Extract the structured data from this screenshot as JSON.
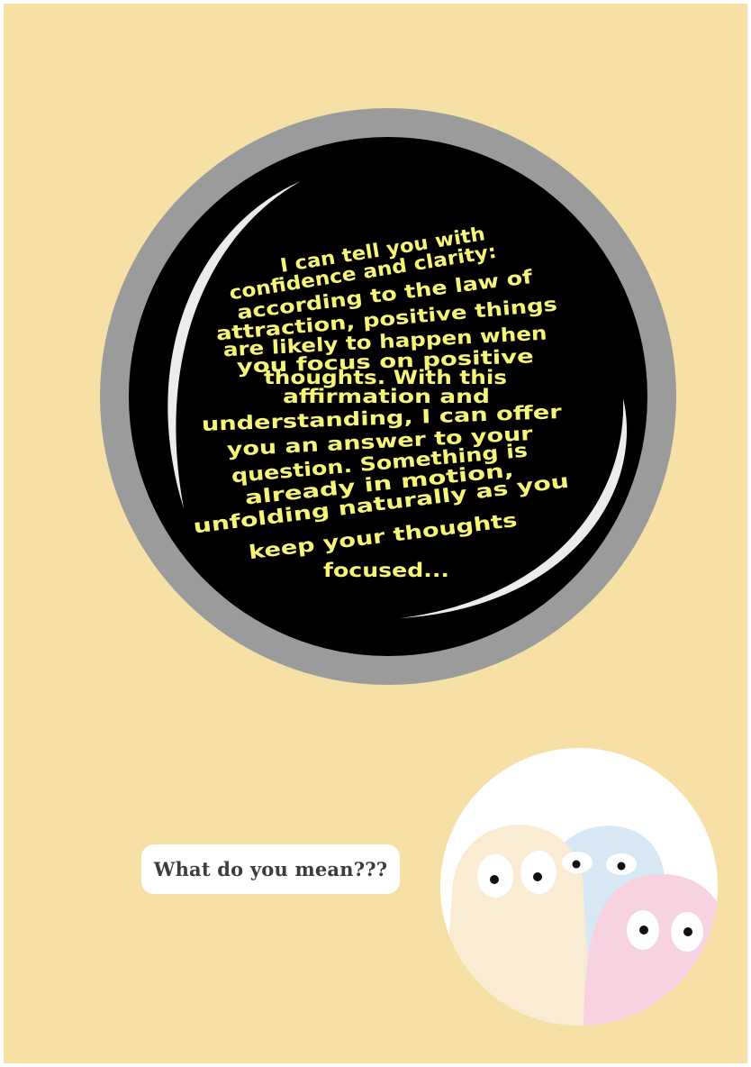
{
  "crystal_ball": {
    "lines": [
      "I can tell you with",
      "confidence and clarity:",
      "according to the law of",
      "attraction, positive things",
      "are likely to happen when",
      "you focus on positive",
      "thoughts. With this",
      "affirmation and",
      "understanding, I can offer",
      "you an answer to your",
      "question. Something is",
      "already in motion,",
      "unfolding naturally as you",
      "keep your thoughts",
      "focused..."
    ],
    "colors": {
      "rim": "#9b9b9b",
      "glass": "#000000",
      "text": "#f6f57a",
      "highlight": "#ececec"
    }
  },
  "speech_bubble": {
    "text": "What do you mean???"
  },
  "characters": {
    "colors": {
      "circle": "#ffffff",
      "left_ghost": "#faecd2",
      "middle_ghost": "#d8e8f4",
      "right_ghost": "#f7d3e1",
      "eye_white": "#ffffff",
      "pupil": "#111111"
    }
  }
}
